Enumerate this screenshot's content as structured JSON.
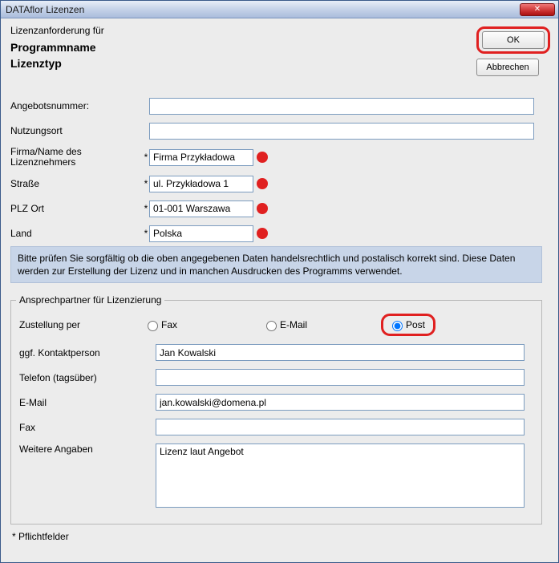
{
  "window": {
    "title": "DATAflor Lizenzen"
  },
  "buttons": {
    "ok": "OK",
    "cancel": "Abbrechen",
    "close_x": "✕"
  },
  "header": {
    "request_for": "Lizenzanforderung für",
    "program_name": "Programmname",
    "license_type": "Lizenztyp"
  },
  "labels": {
    "offer_number": "Angebotsnummer:",
    "usage_location": "Nutzungsort",
    "company": "Firma/Name des Lizenznehmers",
    "street": "Straße",
    "zip_city": "PLZ Ort",
    "country": "Land",
    "asterisk": "*"
  },
  "values": {
    "offer_number": "",
    "usage_location": "",
    "company": "Firma Przykładowa",
    "street": "ul. Przykładowa 1",
    "zip_city": "01-001 Warszawa",
    "country": "Polska"
  },
  "info_text": "Bitte prüfen Sie sorgfältig ob die oben angegebenen Daten handelsrechtlich und postalisch korrekt sind. Diese Daten werden zur Erstellung der Lizenz und in manchen Ausdrucken des Programms verwendet.",
  "contact": {
    "legend": "Ansprechpartner für Lizenzierung",
    "delivery_label": "Zustellung per",
    "fax_option": "Fax",
    "email_option": "E-Mail",
    "post_option": "Post",
    "contact_person_label": "ggf. Kontaktperson",
    "contact_person": "Jan Kowalski",
    "phone_label": "Telefon (tagsüber)",
    "phone": "",
    "email_label": "E-Mail",
    "email": "jan.kowalski@domena.pl",
    "fax_label": "Fax",
    "fax": "",
    "notes_label": "Weitere Angaben",
    "notes": "Lizenz laut Angebot"
  },
  "footer": {
    "mandatory": "* Pflichtfelder"
  }
}
